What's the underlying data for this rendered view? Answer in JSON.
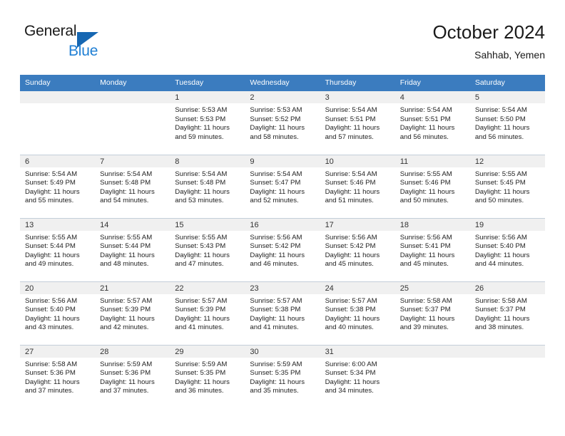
{
  "brand": {
    "name_part1": "General",
    "name_part2": "Blue",
    "triangle_color": "#1667b2",
    "blue_color": "#1f7fd4"
  },
  "header": {
    "title": "October 2024",
    "location": "Sahhab, Yemen"
  },
  "theme": {
    "header_bg": "#3b7cbf",
    "daynum_bg": "#f0f0f0",
    "grid_line": "#c3ced9"
  },
  "columns": [
    "Sunday",
    "Monday",
    "Tuesday",
    "Wednesday",
    "Thursday",
    "Friday",
    "Saturday"
  ],
  "weeks": [
    [
      {
        "day": "",
        "sunrise": "",
        "sunset": "",
        "daylight1": "",
        "daylight2": "",
        "empty": true
      },
      {
        "day": "",
        "sunrise": "",
        "sunset": "",
        "daylight1": "",
        "daylight2": "",
        "empty": true
      },
      {
        "day": "1",
        "sunrise": "Sunrise: 5:53 AM",
        "sunset": "Sunset: 5:53 PM",
        "daylight1": "Daylight: 11 hours",
        "daylight2": "and 59 minutes."
      },
      {
        "day": "2",
        "sunrise": "Sunrise: 5:53 AM",
        "sunset": "Sunset: 5:52 PM",
        "daylight1": "Daylight: 11 hours",
        "daylight2": "and 58 minutes."
      },
      {
        "day": "3",
        "sunrise": "Sunrise: 5:54 AM",
        "sunset": "Sunset: 5:51 PM",
        "daylight1": "Daylight: 11 hours",
        "daylight2": "and 57 minutes."
      },
      {
        "day": "4",
        "sunrise": "Sunrise: 5:54 AM",
        "sunset": "Sunset: 5:51 PM",
        "daylight1": "Daylight: 11 hours",
        "daylight2": "and 56 minutes."
      },
      {
        "day": "5",
        "sunrise": "Sunrise: 5:54 AM",
        "sunset": "Sunset: 5:50 PM",
        "daylight1": "Daylight: 11 hours",
        "daylight2": "and 56 minutes."
      }
    ],
    [
      {
        "day": "6",
        "sunrise": "Sunrise: 5:54 AM",
        "sunset": "Sunset: 5:49 PM",
        "daylight1": "Daylight: 11 hours",
        "daylight2": "and 55 minutes."
      },
      {
        "day": "7",
        "sunrise": "Sunrise: 5:54 AM",
        "sunset": "Sunset: 5:48 PM",
        "daylight1": "Daylight: 11 hours",
        "daylight2": "and 54 minutes."
      },
      {
        "day": "8",
        "sunrise": "Sunrise: 5:54 AM",
        "sunset": "Sunset: 5:48 PM",
        "daylight1": "Daylight: 11 hours",
        "daylight2": "and 53 minutes."
      },
      {
        "day": "9",
        "sunrise": "Sunrise: 5:54 AM",
        "sunset": "Sunset: 5:47 PM",
        "daylight1": "Daylight: 11 hours",
        "daylight2": "and 52 minutes."
      },
      {
        "day": "10",
        "sunrise": "Sunrise: 5:54 AM",
        "sunset": "Sunset: 5:46 PM",
        "daylight1": "Daylight: 11 hours",
        "daylight2": "and 51 minutes."
      },
      {
        "day": "11",
        "sunrise": "Sunrise: 5:55 AM",
        "sunset": "Sunset: 5:46 PM",
        "daylight1": "Daylight: 11 hours",
        "daylight2": "and 50 minutes."
      },
      {
        "day": "12",
        "sunrise": "Sunrise: 5:55 AM",
        "sunset": "Sunset: 5:45 PM",
        "daylight1": "Daylight: 11 hours",
        "daylight2": "and 50 minutes."
      }
    ],
    [
      {
        "day": "13",
        "sunrise": "Sunrise: 5:55 AM",
        "sunset": "Sunset: 5:44 PM",
        "daylight1": "Daylight: 11 hours",
        "daylight2": "and 49 minutes."
      },
      {
        "day": "14",
        "sunrise": "Sunrise: 5:55 AM",
        "sunset": "Sunset: 5:44 PM",
        "daylight1": "Daylight: 11 hours",
        "daylight2": "and 48 minutes."
      },
      {
        "day": "15",
        "sunrise": "Sunrise: 5:55 AM",
        "sunset": "Sunset: 5:43 PM",
        "daylight1": "Daylight: 11 hours",
        "daylight2": "and 47 minutes."
      },
      {
        "day": "16",
        "sunrise": "Sunrise: 5:56 AM",
        "sunset": "Sunset: 5:42 PM",
        "daylight1": "Daylight: 11 hours",
        "daylight2": "and 46 minutes."
      },
      {
        "day": "17",
        "sunrise": "Sunrise: 5:56 AM",
        "sunset": "Sunset: 5:42 PM",
        "daylight1": "Daylight: 11 hours",
        "daylight2": "and 45 minutes."
      },
      {
        "day": "18",
        "sunrise": "Sunrise: 5:56 AM",
        "sunset": "Sunset: 5:41 PM",
        "daylight1": "Daylight: 11 hours",
        "daylight2": "and 45 minutes."
      },
      {
        "day": "19",
        "sunrise": "Sunrise: 5:56 AM",
        "sunset": "Sunset: 5:40 PM",
        "daylight1": "Daylight: 11 hours",
        "daylight2": "and 44 minutes."
      }
    ],
    [
      {
        "day": "20",
        "sunrise": "Sunrise: 5:56 AM",
        "sunset": "Sunset: 5:40 PM",
        "daylight1": "Daylight: 11 hours",
        "daylight2": "and 43 minutes."
      },
      {
        "day": "21",
        "sunrise": "Sunrise: 5:57 AM",
        "sunset": "Sunset: 5:39 PM",
        "daylight1": "Daylight: 11 hours",
        "daylight2": "and 42 minutes."
      },
      {
        "day": "22",
        "sunrise": "Sunrise: 5:57 AM",
        "sunset": "Sunset: 5:39 PM",
        "daylight1": "Daylight: 11 hours",
        "daylight2": "and 41 minutes."
      },
      {
        "day": "23",
        "sunrise": "Sunrise: 5:57 AM",
        "sunset": "Sunset: 5:38 PM",
        "daylight1": "Daylight: 11 hours",
        "daylight2": "and 41 minutes."
      },
      {
        "day": "24",
        "sunrise": "Sunrise: 5:57 AM",
        "sunset": "Sunset: 5:38 PM",
        "daylight1": "Daylight: 11 hours",
        "daylight2": "and 40 minutes."
      },
      {
        "day": "25",
        "sunrise": "Sunrise: 5:58 AM",
        "sunset": "Sunset: 5:37 PM",
        "daylight1": "Daylight: 11 hours",
        "daylight2": "and 39 minutes."
      },
      {
        "day": "26",
        "sunrise": "Sunrise: 5:58 AM",
        "sunset": "Sunset: 5:37 PM",
        "daylight1": "Daylight: 11 hours",
        "daylight2": "and 38 minutes."
      }
    ],
    [
      {
        "day": "27",
        "sunrise": "Sunrise: 5:58 AM",
        "sunset": "Sunset: 5:36 PM",
        "daylight1": "Daylight: 11 hours",
        "daylight2": "and 37 minutes."
      },
      {
        "day": "28",
        "sunrise": "Sunrise: 5:59 AM",
        "sunset": "Sunset: 5:36 PM",
        "daylight1": "Daylight: 11 hours",
        "daylight2": "and 37 minutes."
      },
      {
        "day": "29",
        "sunrise": "Sunrise: 5:59 AM",
        "sunset": "Sunset: 5:35 PM",
        "daylight1": "Daylight: 11 hours",
        "daylight2": "and 36 minutes."
      },
      {
        "day": "30",
        "sunrise": "Sunrise: 5:59 AM",
        "sunset": "Sunset: 5:35 PM",
        "daylight1": "Daylight: 11 hours",
        "daylight2": "and 35 minutes."
      },
      {
        "day": "31",
        "sunrise": "Sunrise: 6:00 AM",
        "sunset": "Sunset: 5:34 PM",
        "daylight1": "Daylight: 11 hours",
        "daylight2": "and 34 minutes."
      },
      {
        "day": "",
        "sunrise": "",
        "sunset": "",
        "daylight1": "",
        "daylight2": "",
        "empty": true
      },
      {
        "day": "",
        "sunrise": "",
        "sunset": "",
        "daylight1": "",
        "daylight2": "",
        "empty": true
      }
    ]
  ]
}
